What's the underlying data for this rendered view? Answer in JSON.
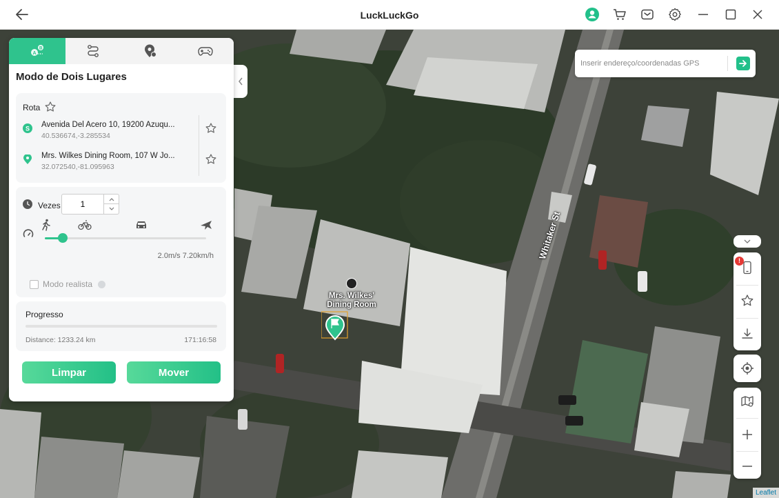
{
  "app": {
    "title": "LuckLuckGo"
  },
  "search": {
    "placeholder": "Inserir endereço/coordenadas GPS"
  },
  "panel": {
    "title": "Modo de Dois Lugares",
    "route": {
      "label": "Rota",
      "start": {
        "address": "Avenida Del Acero 10, 19200 Azuqu...",
        "coords": "40.536674,-3.285534"
      },
      "end": {
        "address": "Mrs. Wilkes Dining Room, 107 W Jo...",
        "coords": "32.072540,-81.095963"
      }
    },
    "repeat": {
      "label": "Vezes",
      "value": "1"
    },
    "speed": {
      "mode": "walk",
      "slider_fraction": 0.11,
      "text": "2.0m/s  7.20km/h"
    },
    "realistic": {
      "label": "Modo realista",
      "checked": false
    },
    "progress": {
      "label": "Progresso",
      "fraction": 0,
      "distance": "Distance: 1233.24 km",
      "time": "171:16:58"
    },
    "buttons": {
      "clear": "Limpar",
      "move": "Mover"
    }
  },
  "map": {
    "street": "Whitaker St",
    "poi": "Mrs. Wilkes' Dining Room",
    "attribution": "Leaflet",
    "notification_badge": "!"
  },
  "colors": {
    "accent": "#2fc38d",
    "badge": "#e53935"
  }
}
